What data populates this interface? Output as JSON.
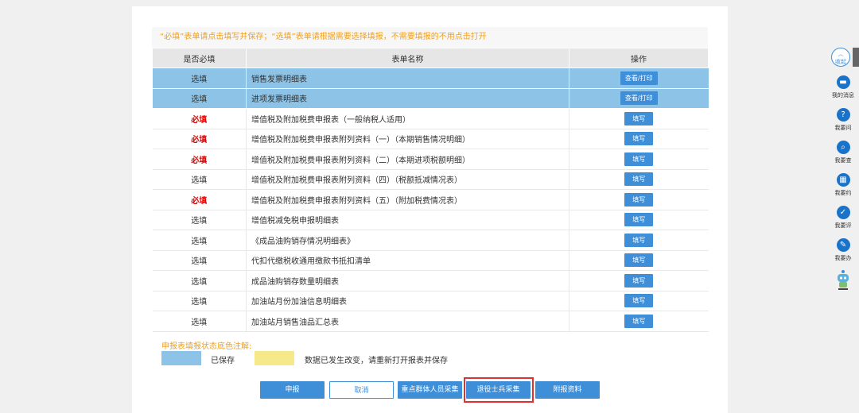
{
  "notice": "“必填”表单请点击填写并保存；“选填”表单请根据需要选择填报，不需要填报的不用点击打开",
  "table": {
    "headers": [
      "是否必填",
      "表单名称",
      "操作"
    ],
    "rows": [
      {
        "req": "选填",
        "name": "销售发票明细表",
        "action": "查看/打印",
        "required": false,
        "saved": true
      },
      {
        "req": "选填",
        "name": "进项发票明细表",
        "action": "查看/打印",
        "required": false,
        "saved": true
      },
      {
        "req": "必填",
        "name": "增值税及附加税费申报表（一般纳税人适用）",
        "action": "填写",
        "required": true,
        "saved": false
      },
      {
        "req": "必填",
        "name": "增值税及附加税费申报表附列资料（一）（本期销售情况明细）",
        "action": "填写",
        "required": true,
        "saved": false
      },
      {
        "req": "必填",
        "name": "增值税及附加税费申报表附列资料（二）（本期进项税额明细）",
        "action": "填写",
        "required": true,
        "saved": false
      },
      {
        "req": "选填",
        "name": "增值税及附加税费申报表附列资料（四）（税额抵减情况表）",
        "action": "填写",
        "required": false,
        "saved": false
      },
      {
        "req": "必填",
        "name": "增值税及附加税费申报表附列资料（五）（附加税费情况表）",
        "action": "填写",
        "required": true,
        "saved": false
      },
      {
        "req": "选填",
        "name": "增值税减免税申报明细表",
        "action": "填写",
        "required": false,
        "saved": false
      },
      {
        "req": "选填",
        "name": "《成品油购销存情况明细表》",
        "action": "填写",
        "required": false,
        "saved": false
      },
      {
        "req": "选填",
        "name": "代扣代缴税收通用缴款书抵扣清单",
        "action": "填写",
        "required": false,
        "saved": false
      },
      {
        "req": "选填",
        "name": "成品油购销存数量明细表",
        "action": "填写",
        "required": false,
        "saved": false
      },
      {
        "req": "选填",
        "name": "加油站月份加油信息明细表",
        "action": "填写",
        "required": false,
        "saved": false
      },
      {
        "req": "选填",
        "name": "加油站月销售油品汇总表",
        "action": "填写",
        "required": false,
        "saved": false
      }
    ]
  },
  "legend": {
    "title": "申报表填报状态底色注解:",
    "saved_label": "已保存",
    "changed_label": "数据已发生改变，请重新打开报表并保存",
    "saved_color": "#8cc3e6",
    "changed_color": "#f5e98a"
  },
  "buttons": {
    "submit": "申报",
    "cancel": "取消",
    "key_group": "重点群体人员采集",
    "veteran": "退役士兵采集",
    "attach": "附报资料"
  },
  "sidebar": {
    "collapse": "收起",
    "items": [
      {
        "label": "我的消息",
        "icon": "message-icon"
      },
      {
        "label": "我要问",
        "icon": "question-icon"
      },
      {
        "label": "我要查",
        "icon": "search-icon"
      },
      {
        "label": "我要约",
        "icon": "calendar-icon"
      },
      {
        "label": "我要评",
        "icon": "rating-icon"
      },
      {
        "label": "我要办",
        "icon": "edit-icon"
      }
    ]
  },
  "colors": {
    "accent": "#3e8ed8",
    "required": "#e00000",
    "notice": "#f0a020",
    "highlight": "#e03030"
  }
}
